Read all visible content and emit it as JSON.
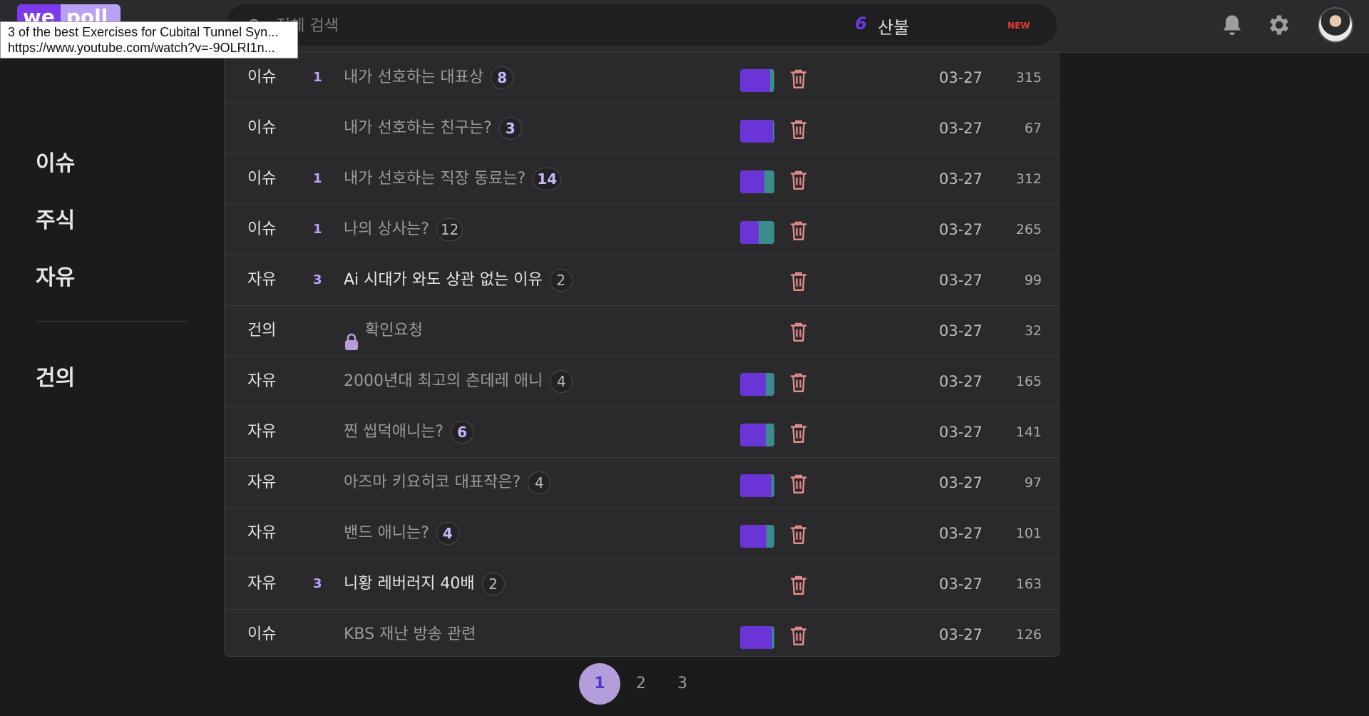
{
  "logo": {
    "part1": "we",
    "part2": "poll"
  },
  "tooltip": {
    "title": "3 of the best Exercises for Cubital Tunnel Syn...",
    "url": "https://www.youtube.com/watch?v=-9OLRI1n..."
  },
  "search": {
    "placeholder": "전체 검색",
    "trend_rank": "6",
    "trend_word": "산불",
    "trend_badge": "NEW"
  },
  "colors": {
    "accent": "#7c3aed",
    "vote_a": "#6a35d6",
    "vote_b": "#3b8c8c",
    "trash": "#e58a8a"
  },
  "sidebar": {
    "items": [
      {
        "label": "이슈"
      },
      {
        "label": "주식"
      },
      {
        "label": "자유"
      }
    ],
    "bottom_items": [
      {
        "label": "건의"
      }
    ]
  },
  "posts": [
    {
      "category": "이슈",
      "rank": "1",
      "title": "내가 선호하는 대표상",
      "comments": "8",
      "comment_style": "purple",
      "bright": false,
      "locked": false,
      "vote_a": 0.88,
      "has_vote": true,
      "date": "03-27",
      "views": "315"
    },
    {
      "category": "이슈",
      "rank": "",
      "title": "내가 선호하는 친구는?",
      "comments": "3",
      "comment_style": "purple",
      "bright": false,
      "locked": false,
      "vote_a": 0.95,
      "has_vote": true,
      "date": "03-27",
      "views": "67"
    },
    {
      "category": "이슈",
      "rank": "1",
      "title": "내가 선호하는 직장 동료는?",
      "comments": "14",
      "comment_style": "purple",
      "bright": false,
      "locked": false,
      "vote_a": 0.7,
      "has_vote": true,
      "date": "03-27",
      "views": "312"
    },
    {
      "category": "이슈",
      "rank": "1",
      "title": "나의 상사는?",
      "comments": "12",
      "comment_style": "gray",
      "bright": false,
      "locked": false,
      "vote_a": 0.55,
      "has_vote": true,
      "date": "03-27",
      "views": "265"
    },
    {
      "category": "자유",
      "rank": "3",
      "title": "Ai 시대가 와도 상관 없는 이유",
      "comments": "2",
      "comment_style": "gray",
      "bright": true,
      "locked": false,
      "vote_a": 0,
      "has_vote": false,
      "date": "03-27",
      "views": "99"
    },
    {
      "category": "건의",
      "rank": "",
      "title": "확인요청",
      "comments": "",
      "comment_style": "gray",
      "bright": false,
      "locked": true,
      "vote_a": 0,
      "has_vote": false,
      "date": "03-27",
      "views": "32"
    },
    {
      "category": "자유",
      "rank": "",
      "title": "2000년대 최고의 츤데레 애니",
      "comments": "4",
      "comment_style": "gray",
      "bright": false,
      "locked": false,
      "vote_a": 0.75,
      "has_vote": true,
      "date": "03-27",
      "views": "165"
    },
    {
      "category": "자유",
      "rank": "",
      "title": "찐 씹덕애니는?",
      "comments": "6",
      "comment_style": "purple",
      "bright": false,
      "locked": false,
      "vote_a": 0.75,
      "has_vote": true,
      "date": "03-27",
      "views": "141"
    },
    {
      "category": "자유",
      "rank": "",
      "title": "아즈마 키요히코 대표작은?",
      "comments": "4",
      "comment_style": "gray",
      "bright": false,
      "locked": false,
      "vote_a": 0.92,
      "has_vote": true,
      "date": "03-27",
      "views": "97"
    },
    {
      "category": "자유",
      "rank": "",
      "title": "밴드 애니는?",
      "comments": "4",
      "comment_style": "purple",
      "bright": false,
      "locked": false,
      "vote_a": 0.78,
      "has_vote": true,
      "date": "03-27",
      "views": "101"
    },
    {
      "category": "자유",
      "rank": "3",
      "title": "니황 레버러지 40배",
      "comments": "2",
      "comment_style": "gray",
      "bright": true,
      "locked": false,
      "vote_a": 0,
      "has_vote": false,
      "date": "03-27",
      "views": "163"
    },
    {
      "category": "이슈",
      "rank": "",
      "title": "KBS 재난 방송 관련",
      "comments": "",
      "comment_style": "gray",
      "bright": false,
      "locked": false,
      "vote_a": 0.93,
      "has_vote": true,
      "date": "03-27",
      "views": "126"
    }
  ],
  "pagination": {
    "pages": [
      "1",
      "2",
      "3"
    ],
    "current": "1"
  }
}
